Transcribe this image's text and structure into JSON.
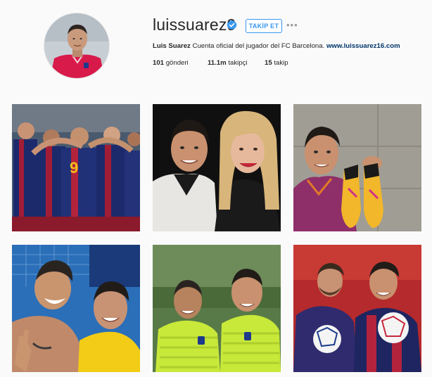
{
  "profile": {
    "username": "luissuarez9",
    "follow_label": "TAKİP ET",
    "more_label": "•••",
    "full_name": "Luis Suarez",
    "bio_text": "Cuenta oficial del jugador del FC Barcelona.",
    "website": "www.luissuarez16.com",
    "stats": {
      "posts_count": "101",
      "posts_label": "gönderi",
      "followers_count": "11.1m",
      "followers_label": "takipçi",
      "following_count": "15",
      "following_label": "takip"
    },
    "verified_color": "#3897f0"
  },
  "icons": {
    "verified": "verified-badge-icon",
    "more": "more-options-icon"
  },
  "posts": [
    {
      "kind": "team-celebration",
      "palette": [
        "#1b2a6b",
        "#a31c36"
      ]
    },
    {
      "kind": "selfie-couple",
      "palette": [
        "#0e0e0e",
        "#d9b67c"
      ]
    },
    {
      "kind": "player-with-boots",
      "palette": [
        "#9f9c94",
        "#f2b72a"
      ]
    },
    {
      "kind": "selfie-teammates",
      "palette": [
        "#2a6fb8",
        "#f2cc16"
      ]
    },
    {
      "kind": "training-teammates",
      "palette": [
        "#4a7a3a",
        "#c8e83a"
      ]
    },
    {
      "kind": "players-with-ball",
      "palette": [
        "#b8282c",
        "#2f2b6e"
      ]
    }
  ]
}
